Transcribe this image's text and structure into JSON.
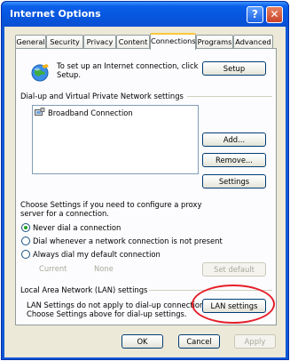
{
  "window": {
    "title": "Internet Options",
    "help": "?",
    "close": "✕"
  },
  "tabs": [
    "General",
    "Security",
    "Privacy",
    "Content",
    "Connections",
    "Programs",
    "Advanced"
  ],
  "active_tab": "Connections",
  "setup": {
    "text_line1": "To set up an Internet connection, click",
    "text_line2": "Setup.",
    "button": "Setup"
  },
  "dialup": {
    "heading": "Dial-up and Virtual Private Network settings",
    "connections": [
      "Broadband Connection"
    ],
    "add_button": "Add...",
    "remove_button": "Remove...",
    "settings_button": "Settings"
  },
  "proxy": {
    "line1": "Choose Settings if you need to configure a proxy",
    "line2": "server for a connection."
  },
  "dial_options": {
    "never": "Never dial a connection",
    "whenever": "Dial whenever a network connection is not present",
    "always": "Always dial my default connection",
    "selected": "never"
  },
  "current": {
    "label": "Current",
    "value": "None",
    "set_default_button": "Set default"
  },
  "lan": {
    "heading": "Local Area Network (LAN) settings",
    "line1": "LAN Settings do not apply to dial-up connections.",
    "line2": "Choose Settings above for dial-up settings.",
    "button": "LAN settings"
  },
  "footer": {
    "ok": "OK",
    "cancel": "Cancel",
    "apply": "Apply"
  },
  "colors": {
    "titlebar": "#0a5fe8",
    "dialog_bg": "#ece9d8",
    "highlight_ring": "#e5202a",
    "tab_accent": "#ffc83c"
  }
}
